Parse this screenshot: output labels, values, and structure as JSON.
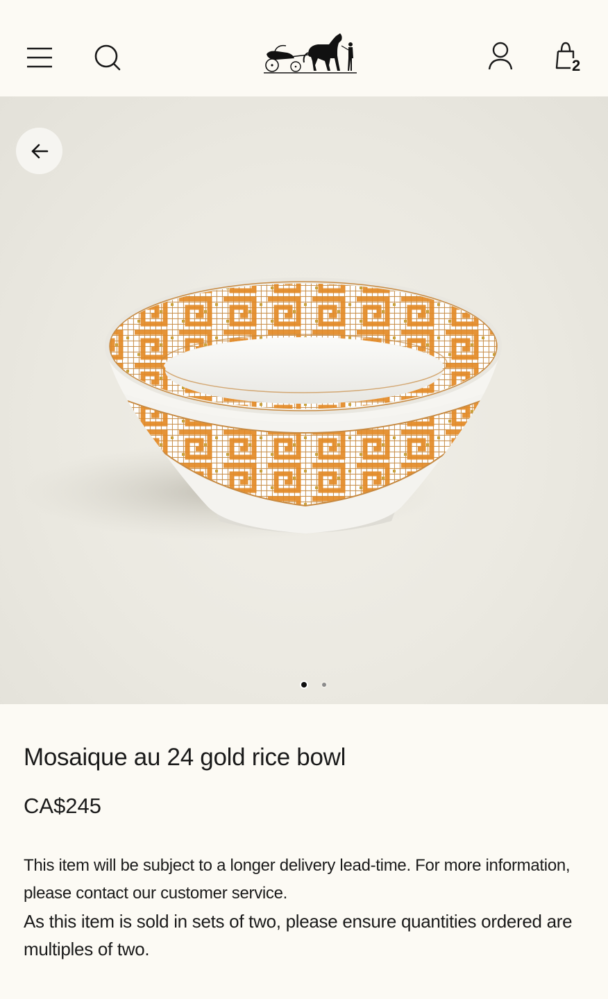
{
  "header": {
    "menu_icon": "hamburger-menu-icon",
    "search_icon": "search-icon",
    "logo_icon": "horse-carriage-logo",
    "account_icon": "user-icon",
    "bag_icon": "shopping-bag-icon",
    "bag_count": "2"
  },
  "gallery": {
    "back_icon": "arrow-left-icon",
    "image": "porcelain-rice-bowl-photo",
    "slide_count": 2,
    "active_slide": 1
  },
  "product": {
    "title": "Mosaique au 24 gold rice bowl",
    "price": "CA$245",
    "notice_1": "This item will be subject to a longer delivery lead-time. For more information, please contact our customer service.",
    "notice_2": "As this item is sold in sets of two, please ensure quantities ordered are multiples of two."
  },
  "colors": {
    "background": "#fcfaf4",
    "accent_orange": "#e08a2a",
    "gold": "#c9a23c"
  }
}
